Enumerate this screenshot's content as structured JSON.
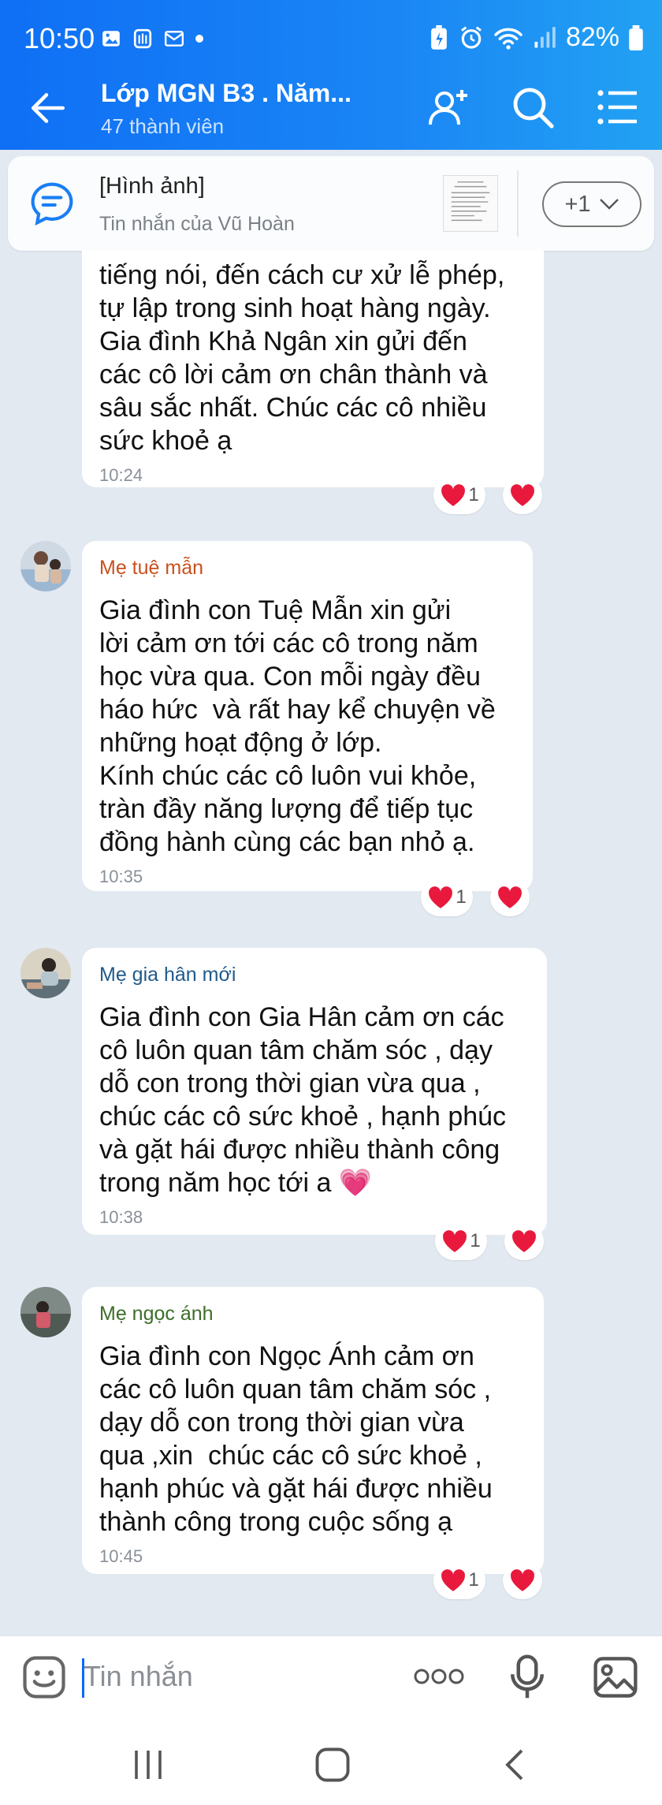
{
  "status_bar": {
    "time": "10:50",
    "battery": "82%"
  },
  "header": {
    "title": "Lớp MGN B3 . Năm...",
    "subtitle": "47 thành viên"
  },
  "pinned": {
    "title": "[Hình ảnh]",
    "subtitle": "Tin nhắn của Vũ Hoàn",
    "more_label": "+1"
  },
  "colors": {
    "header_start": "#0f6ff5",
    "header_end": "#22a2f3",
    "chat_bg": "#e2e9f1",
    "heart": "#e8193c"
  },
  "messages": [
    {
      "sender": "",
      "text": "tiếng nói, đến cách cư xử lễ phép,\ntự lập trong sinh hoạt hàng ngày.\nGia đình Khả Ngân xin gửi đến\ncác cô lời cảm ơn chân thành và\nsâu sắc nhất. Chúc các cô nhiều\nsức khoẻ ạ",
      "time": "10:24",
      "reaction_count": "1"
    },
    {
      "sender": "Mẹ tuệ mẫn",
      "sender_color": "#c8501e",
      "text": "Gia đình con Tuệ Mẫn xin gửi\nlời cảm ơn tới các cô trong năm\nhọc vừa qua. Con mỗi ngày đều\nháo hức  và rất hay kể chuyện về\nnhững hoạt động ở lớp.\nKính chúc các cô luôn vui khỏe,\ntràn đầy năng lượng để tiếp tục\nđồng hành cùng các bạn nhỏ ạ.",
      "time": "10:35",
      "reaction_count": "1"
    },
    {
      "sender": "Mẹ gia hân mới",
      "sender_color": "#1e5a8c",
      "text": "Gia đình con Gia Hân cảm ơn các\ncô luôn quan tâm chăm sóc , dạy\ndỗ con trong thời gian vừa qua ,\nchúc các cô sức khoẻ , hạnh phúc\nvà gặt hái được nhiều thành công\ntrong năm học tới a 💗",
      "time": "10:38",
      "reaction_count": "1"
    },
    {
      "sender": "Mẹ ngọc ánh",
      "sender_color": "#3c6e28",
      "text": "Gia đình con Ngọc Ánh cảm ơn\ncác cô luôn quan tâm chăm sóc ,\ndạy dỗ con trong thời gian vừa\nqua ,xin  chúc các cô sức khoẻ ,\nhạnh phúc và gặt hái được nhiều\nthành công trong cuộc sống ạ",
      "time": "10:45",
      "reaction_count": "1"
    }
  ],
  "composer": {
    "placeholder": "Tin nhắn"
  },
  "icons": {
    "status": [
      "image-icon",
      "gallery-icon",
      "mail-icon",
      "alarm-icon",
      "wifi-icon",
      "signal-icon",
      "battery-icon"
    ],
    "header": [
      "back-arrow-icon",
      "add-member-icon",
      "search-icon",
      "menu-icon"
    ],
    "composer": [
      "emoji-icon",
      "more-dots-icon",
      "microphone-icon",
      "image-icon"
    ],
    "navbar": [
      "recent-apps-icon",
      "home-icon",
      "back-icon"
    ]
  }
}
